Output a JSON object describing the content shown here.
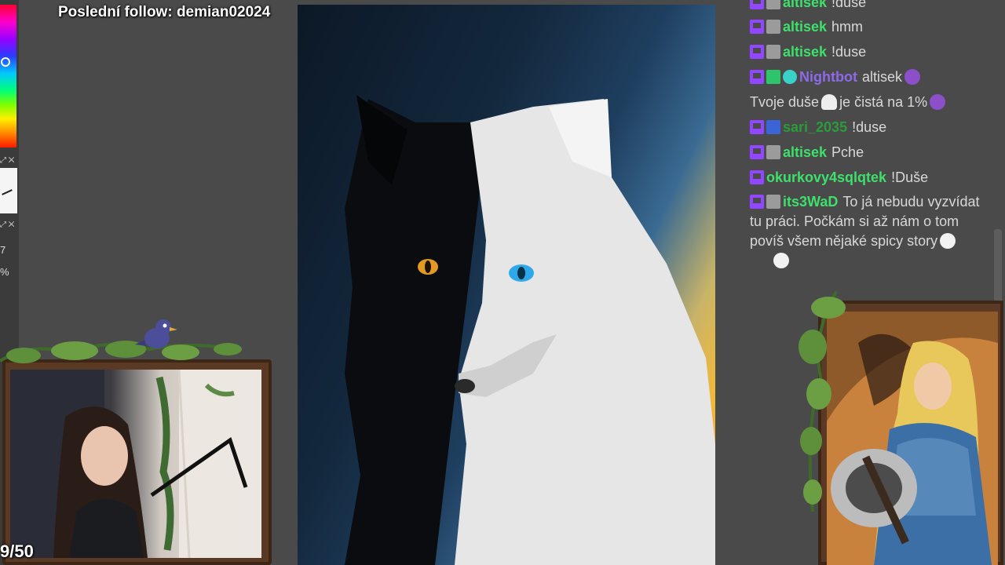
{
  "overlay": {
    "follow_text": "Poslední follow: demian02024",
    "counter": "9/50"
  },
  "tools": {
    "row1_icons": "⤢ ✕",
    "row2_icons": "⤢ ✕",
    "value_1": "7",
    "value_2": "%"
  },
  "chat": {
    "messages": [
      {
        "user": "altisek",
        "text": "!duse",
        "color": "#3ee06b"
      },
      {
        "user": "altisek",
        "text": "hmm",
        "color": "#3ee06b"
      },
      {
        "user": "altisek",
        "text": "!duse",
        "color": "#3ee06b"
      },
      {
        "user": "Nightbot",
        "text": "altisek",
        "color": "#8d6ae8"
      },
      {
        "user": "",
        "text": "Tvoje duše",
        "text2": "je čistá na 1%",
        "color": "#d8d8d8"
      },
      {
        "user": "sari_2035",
        "text": "!duse",
        "color": "#2b9c3b"
      },
      {
        "user": "altisek",
        "text": "Pche",
        "color": "#3ee06b"
      },
      {
        "user": "okurkovy4sqlqtek",
        "text": "!Duše",
        "color": "#3ee06b"
      },
      {
        "user": "its3WaD",
        "text": "To já nebudu vyzvídat tu práci. Počkám si až nám o tom povíš všem nějaké spicy story",
        "color": "#3ee06b"
      }
    ]
  },
  "colors": {
    "twitch_purple": "#9146ff",
    "chat_green": "#3ee06b",
    "nightbot_purple": "#8d6ae8"
  },
  "icons": [
    "twitch-badge-icon",
    "verified-badge-icon",
    "robot-badge-icon",
    "ghost-emote-icon",
    "devil-emote-icon",
    "smile-emote-icon"
  ]
}
